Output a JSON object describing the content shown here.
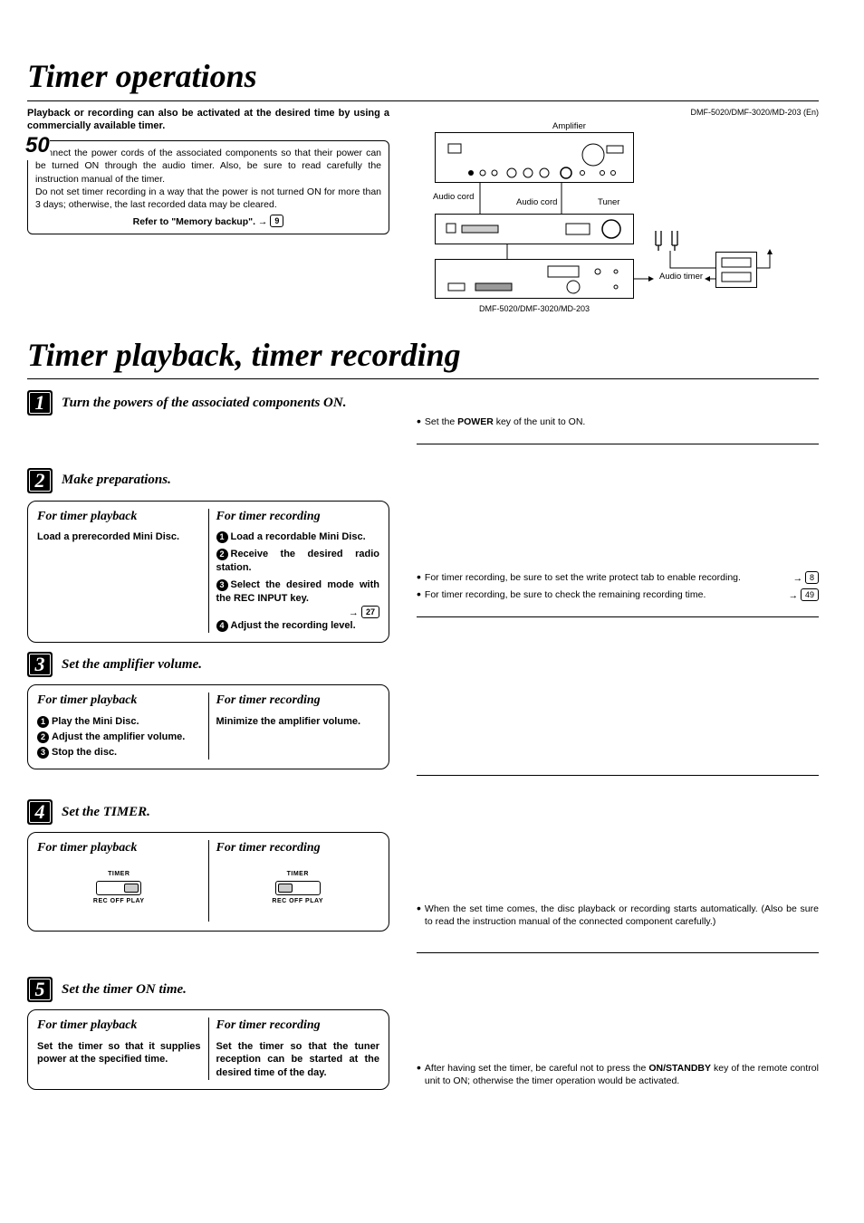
{
  "page_number": "50",
  "doc_header_right": "DMF-5020/DMF-3020/MD-203 (En)",
  "title1": "Timer operations",
  "intro_bold": "Playback or recording can also be activated at the desired time by using a commercially available timer.",
  "info_box": "Connect the power cords of the associated components so that their power can be turned ON through the audio timer. Also, be sure to read carefully the instruction manual of the timer.\nDo not set timer recording in a way that the power is not turned ON for more than 3 days; otherwise, the last recorded data may be cleared.",
  "info_ref_text": "Refer to \"Memory backup\". →",
  "info_ref_page": "9",
  "diagram": {
    "amp_label": "Amplifier",
    "tuner_label": "Tuner",
    "audio_timer_label": "Audio timer",
    "audio_cord_label": "Audio cord",
    "unit_caption": "DMF-5020/DMF-3020/MD-203"
  },
  "title2": "Timer playback, timer recording",
  "steps": {
    "s1": {
      "num": "1",
      "title": "Turn the powers of the associated components ON.",
      "right_bullet": "Set the POWER key of the unit to ON.",
      "right_bullet_bold": "POWER"
    },
    "s2": {
      "num": "2",
      "title": "Make preparations.",
      "left_h": "For timer playback",
      "left_body": "Load a prerecorded Mini Disc.",
      "right_h": "For timer recording",
      "r_items": {
        "i1": "Load a recordable Mini Disc.",
        "i2": "Receive the desired radio station.",
        "i3": "Select the desired mode with the REC INPUT key.",
        "i3_ref": "27",
        "i4": "Adjust the recording level."
      },
      "right_notes": {
        "n1": "For timer recording, be sure to set the write protect tab to enable recording.",
        "n1_ref": "8",
        "n2": "For timer recording, be sure to check the remaining recording time.",
        "n2_ref": "49"
      }
    },
    "s3": {
      "num": "3",
      "title": "Set the amplifier volume.",
      "left_h": "For timer playback",
      "l_items": {
        "i1": "Play the Mini Disc.",
        "i2": "Adjust the amplifier volume.",
        "i3": "Stop the disc."
      },
      "right_h": "For timer recording",
      "right_body": "Minimize the amplifier volume."
    },
    "s4": {
      "num": "4",
      "title": "Set the TIMER.",
      "left_h": "For timer playback",
      "right_h": "For timer recording",
      "switch_top": "TIMER",
      "switch_bottom": "REC  OFF  PLAY",
      "right_note": "When the set time comes, the disc playback or recording starts automatically. (Also be sure to read the instruction manual of the connected component carefully.)"
    },
    "s5": {
      "num": "5",
      "title": "Set the timer ON time.",
      "left_h": "For timer playback",
      "left_body": "Set the timer so that it supplies power at the specified time.",
      "right_h": "For timer recording",
      "right_body": "Set the timer so that the tuner reception can be started at the desired time of the day.",
      "right_note_a": "After having set the timer, be careful not to press the ",
      "right_note_bold": "ON/STANDBY",
      "right_note_b": " key of the remote control unit to ON; otherwise the timer operation would be activated."
    }
  }
}
